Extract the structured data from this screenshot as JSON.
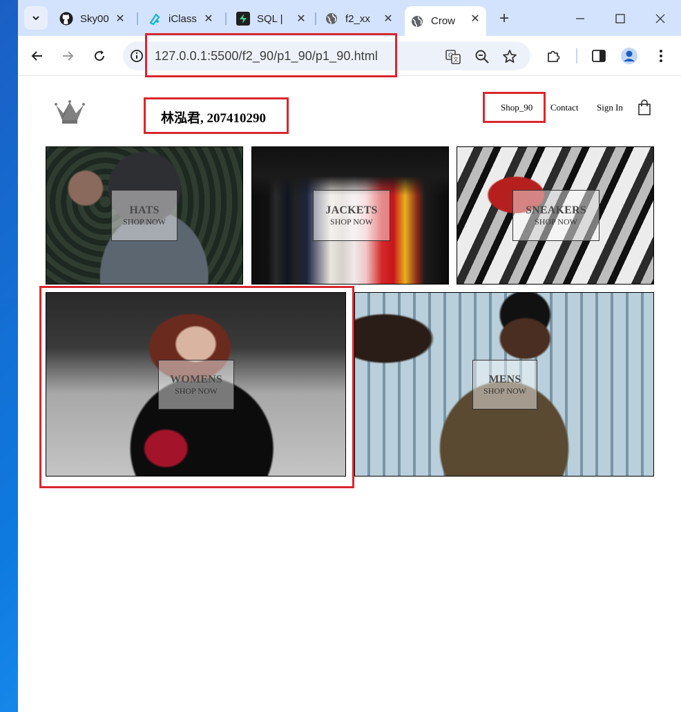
{
  "browser": {
    "tabs": [
      {
        "label": "Sky00",
        "icon": "github-icon",
        "close": "✕"
      },
      {
        "label": "iClass",
        "icon": "iclass-icon",
        "close": "✕"
      },
      {
        "label": "SQL |",
        "icon": "supabase-icon",
        "close": "✕"
      },
      {
        "label": "f2_xx",
        "icon": "globe-icon",
        "close": "✕"
      },
      {
        "label": "Crow",
        "icon": "globe-icon",
        "close": "✕",
        "active": true
      }
    ],
    "new_tab": "+",
    "url": "127.0.0.1:5500/f2_90/p1_90/p1_90.html"
  },
  "page": {
    "title": "林泓君, 207410290",
    "nav": {
      "shop": "Shop_90",
      "contact": "Contact",
      "signin": "Sign In"
    },
    "categories": [
      {
        "title": "HATS",
        "subtitle": "SHOP NOW"
      },
      {
        "title": "JACKETS",
        "subtitle": "SHOP NOW"
      },
      {
        "title": "SNEAKERS",
        "subtitle": "SHOP NOW"
      },
      {
        "title": "WOMENS",
        "subtitle": "SHOP NOW"
      },
      {
        "title": "MENS",
        "subtitle": "SHOP NOW"
      }
    ]
  },
  "colors": {
    "annotation_red": "#d9262e",
    "tab_strip": "#d3e3fd",
    "omnibox": "#edf2fa"
  }
}
